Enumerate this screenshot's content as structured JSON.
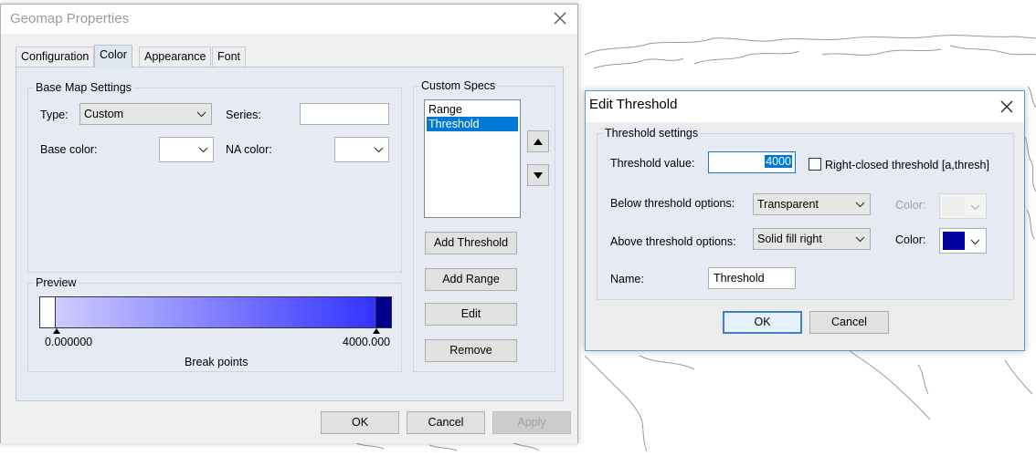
{
  "geomap_properties": {
    "title": "Geomap Properties",
    "tabs": [
      {
        "label": "Configuration"
      },
      {
        "label": "Color"
      },
      {
        "label": "Appearance"
      },
      {
        "label": "Font"
      }
    ],
    "active_tab": "Color",
    "base_map_settings": {
      "group_label": "Base Map Settings",
      "type_label": "Type:",
      "type_value": "Custom",
      "series_label": "Series:",
      "series_value": "",
      "base_color_label": "Base color:",
      "na_color_label": "NA color:"
    },
    "preview": {
      "group_label": "Preview",
      "min_label": "0.000000",
      "max_label": "4000.000",
      "caption": "Break points",
      "gradient_start_color": "#d7d3ff",
      "gradient_end_color": "#2b2bff",
      "below_color": "#ffffff",
      "above_color": "#00008b"
    },
    "custom_specs": {
      "group_label": "Custom Specs",
      "items": [
        "Range",
        "Threshold"
      ],
      "selected_index": 1,
      "add_threshold_label": "Add Threshold",
      "add_range_label": "Add Range",
      "edit_label": "Edit",
      "remove_label": "Remove"
    },
    "footer": {
      "ok_label": "OK",
      "cancel_label": "Cancel",
      "apply_label": "Apply"
    }
  },
  "edit_threshold": {
    "title": "Edit Threshold",
    "group_label": "Threshold settings",
    "threshold_value_label": "Threshold value:",
    "threshold_value": "4000",
    "right_closed_label": "Right-closed threshold [a,thresh]",
    "right_closed_checked": false,
    "below_options_label": "Below threshold options:",
    "below_option_value": "Transparent",
    "below_color_label": "Color:",
    "above_options_label": "Above threshold options:",
    "above_option_value": "Solid fill right",
    "above_color_label": "Color:",
    "above_color": "#00009c",
    "name_label": "Name:",
    "name_value": "Threshold",
    "ok_label": "OK",
    "cancel_label": "Cancel"
  }
}
